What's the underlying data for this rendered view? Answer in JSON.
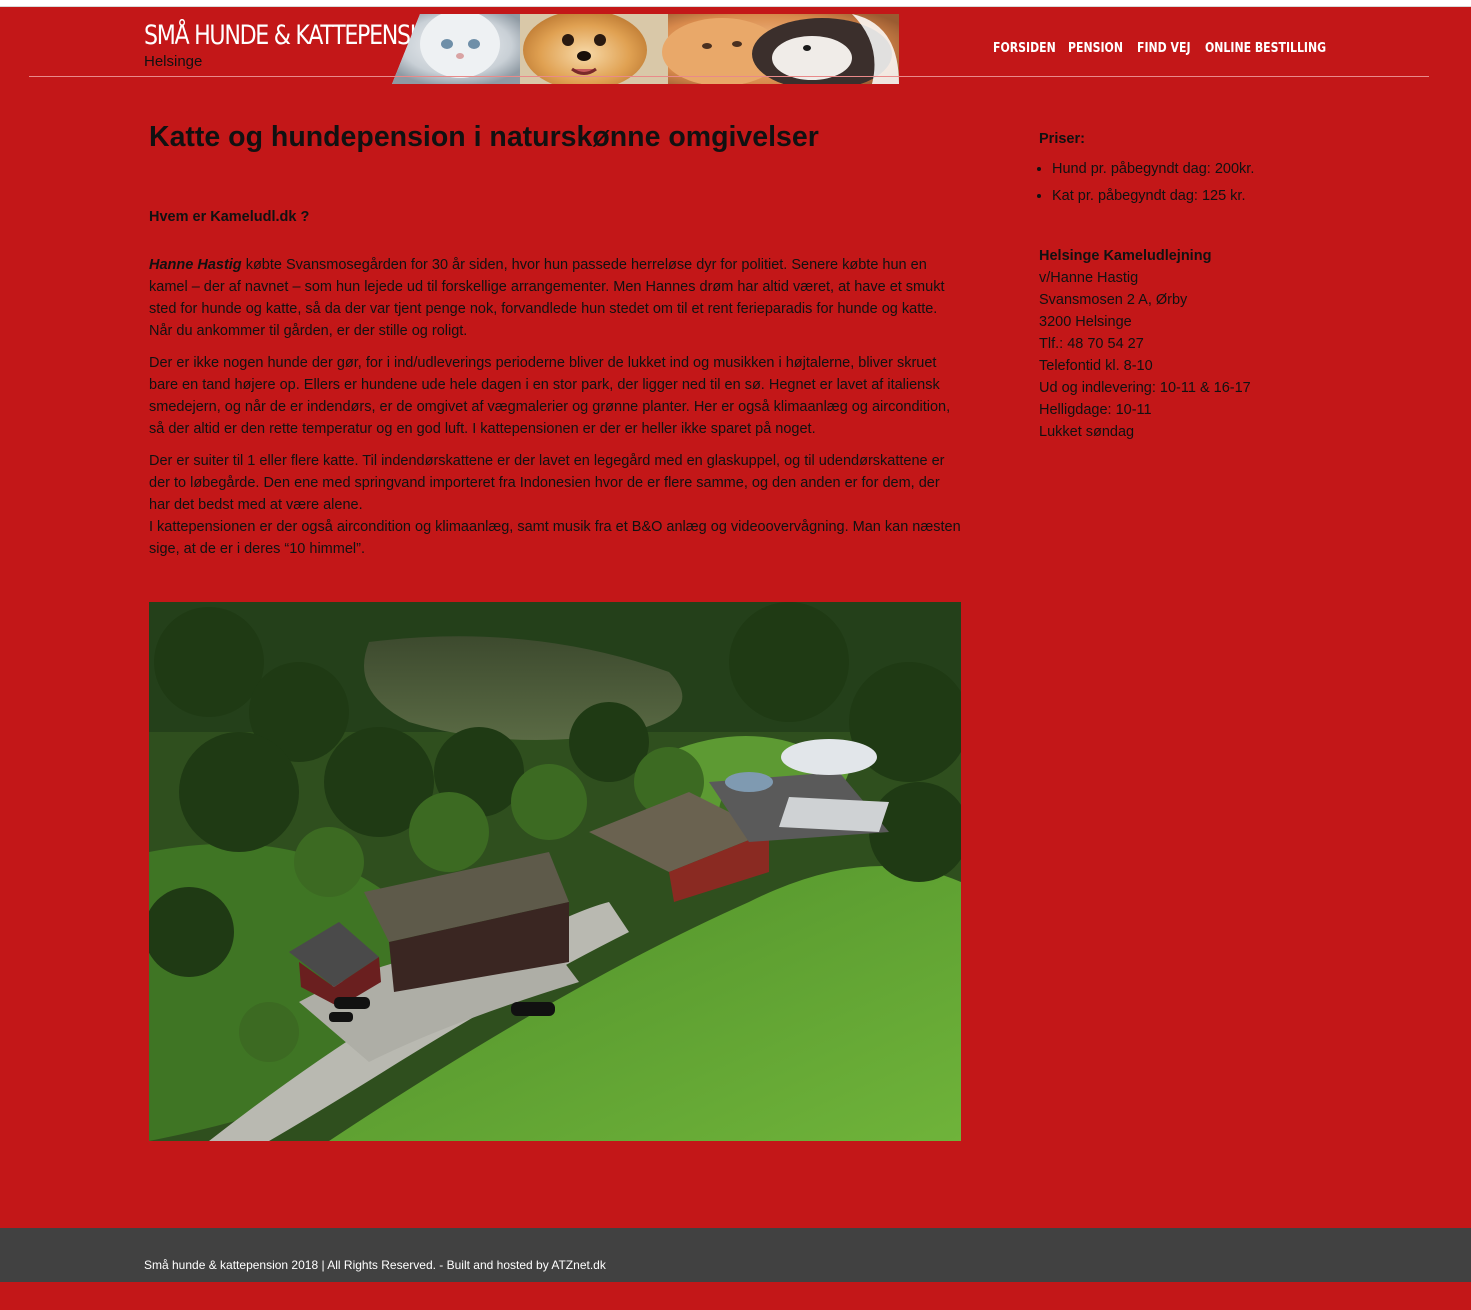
{
  "header": {
    "site_title": "SMÅ HUNDE & KATTEPENSION",
    "site_subtitle": "Helsinge"
  },
  "nav": {
    "items": [
      {
        "label": "FORSIDEN"
      },
      {
        "label": "PENSION"
      },
      {
        "label": "FIND VEJ"
      },
      {
        "label": "ONLINE BESTILLING"
      }
    ]
  },
  "main": {
    "title": "Katte og hundepension i naturskønne omgivelser",
    "who_heading": "Hvem er Kameludl.dk ?",
    "p1_name": "Hanne Hastig",
    "p1_text": " købte Svansmosegården for 30 år siden, hvor hun passede herreløse dyr for politiet. Senere købte hun en kamel – der af navnet – som hun lejede ud til forskellige arrangementer. Men Hannes drøm har altid været, at have et smukt sted for hunde og katte, så da der var tjent penge nok, forvandlede hun stedet om til et rent ferieparadis for hunde og katte. Når du ankommer til gården, er der stille og roligt.",
    "p2": "Der er ikke nogen hunde der gør, for i ind/udleverings perioderne bliver de lukket ind og musikken i højtalerne, bliver skruet bare en tand højere op. Ellers er hundene ude hele dagen i en stor park, der ligger ned til en sø. Hegnet er lavet af italiensk smedejern, og når de er indendørs, er de omgivet af vægmalerier og grønne planter. Her er også klimaanlæg og aircondition, så der altid er den rette temperatur og en god luft. I kattepensionen er der er heller ikke sparet på noget.",
    "p3a": "Der er suiter til 1 eller flere katte. Til indendørskattene er der lavet en legegård med en glaskuppel, og til udendørskattene er der to løbegårde. Den ene med springvand importeret fra Indonesien hvor de er flere samme, og den anden er for dem, der har det bedst med at være alene.",
    "p3b": "I kattepensionen er der også aircondition og klimaanlæg, samt musik fra et B&O anlæg og videoovervågning. Man kan næsten sige, at de er i deres “10 himmel”."
  },
  "sidebar": {
    "prices_title": "Priser:",
    "prices": [
      "Hund pr. påbegyndt dag: 200kr.",
      "Kat pr. påbegyndt dag: 125 kr."
    ],
    "contact_name": "Helsinge Kameludlejning",
    "contact_lines": [
      "v/Hanne Hastig",
      "Svansmosen 2 A, Ørby",
      "3200 Helsinge",
      "Tlf.: 48 70 54 27",
      "Telefontid kl. 8-10",
      "Ud og indlevering: 10-11 & 16-17",
      "Helligdage: 10-11",
      "Lukket søndag"
    ]
  },
  "footer": {
    "text": "Små hunde & kattepension 2018 | All Rights Reserved. - Built and hosted by ATZnet.dk"
  },
  "colors": {
    "background": "#c31718",
    "footer": "#414141",
    "text": "#111111",
    "nav_text": "#ffffff"
  }
}
